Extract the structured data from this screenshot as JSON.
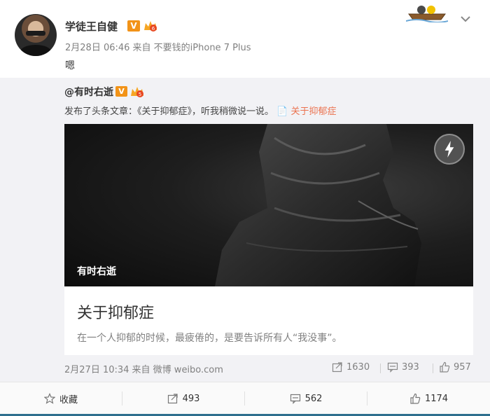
{
  "header": {
    "username": "学徒王自健",
    "verified_badge": "V",
    "meta": "2月28日 06:46 来自 不要钱的iPhone 7 Plus",
    "text": "嗯"
  },
  "repost": {
    "author": "@有时右逝",
    "verified_badge": "V",
    "description_prefix": "发布了头条文章：《关于抑郁症》，听我稍微说一说。",
    "description_link": "📄 关于抑郁症",
    "card": {
      "image_caption": "有时右逝",
      "title": "关于抑郁症",
      "summary": "在一个人抑郁的时候，最疲倦的，是要告诉所有人“我没事”。"
    },
    "footer": {
      "time": "2月27日 10:34 来自 微博 weibo.com",
      "reposts": "1630",
      "comments": "393",
      "likes": "957"
    }
  },
  "actions": {
    "favorite_label": "收藏",
    "repost_count": "493",
    "comment_count": "562",
    "like_count": "1174"
  },
  "colors": {
    "accent_link": "#eb7350",
    "verified_orange": "#f29318",
    "repost_bg": "#f2f2f5"
  }
}
